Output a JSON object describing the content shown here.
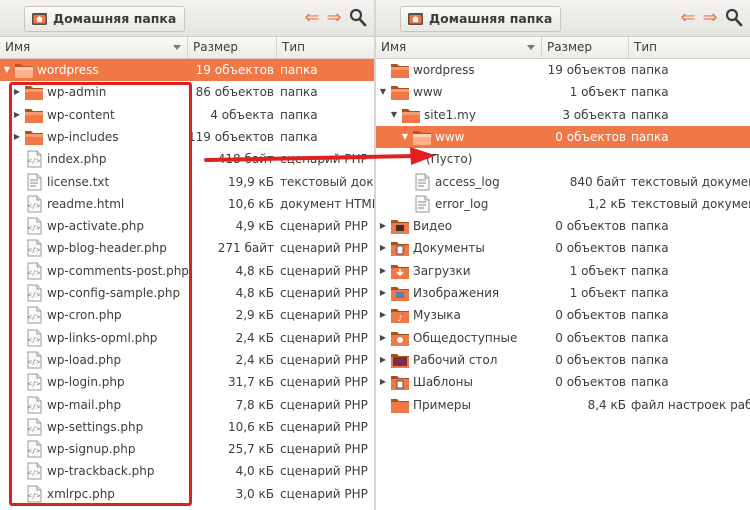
{
  "left_pane": {
    "location": "Домашняя папка",
    "columns": {
      "name": "Имя",
      "size": "Размер",
      "type": "Тип"
    },
    "rows": [
      {
        "name": "wordpress",
        "size": "19 объектов",
        "type": "папка",
        "kind": "folder",
        "expander": "open",
        "depth": 0,
        "selected": true
      },
      {
        "name": "wp-admin",
        "size": "86 объектов",
        "type": "папка",
        "kind": "folder",
        "expander": "closed",
        "depth": 1
      },
      {
        "name": "wp-content",
        "size": "4 объекта",
        "type": "папка",
        "kind": "folder",
        "expander": "closed",
        "depth": 1
      },
      {
        "name": "wp-includes",
        "size": "119 объектов",
        "type": "папка",
        "kind": "folder",
        "expander": "closed",
        "depth": 1
      },
      {
        "name": "index.php",
        "size": "418 байт",
        "type": "сценарий PHP",
        "kind": "script",
        "depth": 1
      },
      {
        "name": "license.txt",
        "size": "19,9 кБ",
        "type": "текстовый документ",
        "kind": "text",
        "depth": 1
      },
      {
        "name": "readme.html",
        "size": "10,6 кБ",
        "type": "документ HTML",
        "kind": "html",
        "depth": 1
      },
      {
        "name": "wp-activate.php",
        "size": "4,9 кБ",
        "type": "сценарий PHP",
        "kind": "script",
        "depth": 1
      },
      {
        "name": "wp-blog-header.php",
        "size": "271 байт",
        "type": "сценарий PHP",
        "kind": "script",
        "depth": 1
      },
      {
        "name": "wp-comments-post.php",
        "size": "4,8 кБ",
        "type": "сценарий PHP",
        "kind": "script",
        "depth": 1
      },
      {
        "name": "wp-config-sample.php",
        "size": "4,8 кБ",
        "type": "сценарий PHP",
        "kind": "script",
        "depth": 1
      },
      {
        "name": "wp-cron.php",
        "size": "2,9 кБ",
        "type": "сценарий PHP",
        "kind": "script",
        "depth": 1
      },
      {
        "name": "wp-links-opml.php",
        "size": "2,4 кБ",
        "type": "сценарий PHP",
        "kind": "script",
        "depth": 1
      },
      {
        "name": "wp-load.php",
        "size": "2,4 кБ",
        "type": "сценарий PHP",
        "kind": "script",
        "depth": 1
      },
      {
        "name": "wp-login.php",
        "size": "31,7 кБ",
        "type": "сценарий PHP",
        "kind": "script",
        "depth": 1
      },
      {
        "name": "wp-mail.php",
        "size": "7,8 кБ",
        "type": "сценарий PHP",
        "kind": "script",
        "depth": 1
      },
      {
        "name": "wp-settings.php",
        "size": "10,6 кБ",
        "type": "сценарий PHP",
        "kind": "script",
        "depth": 1
      },
      {
        "name": "wp-signup.php",
        "size": "25,7 кБ",
        "type": "сценарий PHP",
        "kind": "script",
        "depth": 1
      },
      {
        "name": "wp-trackback.php",
        "size": "4,0 кБ",
        "type": "сценарий PHP",
        "kind": "script",
        "depth": 1
      },
      {
        "name": "xmlrpc.php",
        "size": "3,0 кБ",
        "type": "сценарий PHP",
        "kind": "script",
        "depth": 1
      }
    ]
  },
  "right_pane": {
    "location": "Домашняя папка",
    "columns": {
      "name": "Имя",
      "size": "Размер",
      "type": "Тип"
    },
    "rows": [
      {
        "name": "wordpress",
        "size": "19 объектов",
        "type": "папка",
        "kind": "folder",
        "depth": 0
      },
      {
        "name": "www",
        "size": "1 объект",
        "type": "папка",
        "kind": "folder",
        "expander": "open",
        "depth": 0
      },
      {
        "name": "site1.my",
        "size": "3 объекта",
        "type": "папка",
        "kind": "folder",
        "expander": "open",
        "depth": 1
      },
      {
        "name": "www",
        "size": "0 объектов",
        "type": "папка",
        "kind": "folder",
        "expander": "open",
        "depth": 2,
        "selected": true
      },
      {
        "name": "(Пусто)",
        "size": "",
        "type": "",
        "kind": "none",
        "depth": 3
      },
      {
        "name": "access_log",
        "size": "840 байт",
        "type": "текстовый документ",
        "kind": "text",
        "depth": 2
      },
      {
        "name": "error_log",
        "size": "1,2 кБ",
        "type": "текстовый документ",
        "kind": "text",
        "depth": 2
      },
      {
        "name": "Видео",
        "size": "0 объектов",
        "type": "папка",
        "kind": "video",
        "expander": "closed",
        "depth": 0
      },
      {
        "name": "Документы",
        "size": "0 объектов",
        "type": "папка",
        "kind": "docs",
        "expander": "closed",
        "depth": 0
      },
      {
        "name": "Загрузки",
        "size": "1 объект",
        "type": "папка",
        "kind": "downloads",
        "expander": "closed",
        "depth": 0
      },
      {
        "name": "Изображения",
        "size": "1 объект",
        "type": "папка",
        "kind": "pictures",
        "expander": "closed",
        "depth": 0
      },
      {
        "name": "Музыка",
        "size": "0 объектов",
        "type": "папка",
        "kind": "music",
        "expander": "closed",
        "depth": 0
      },
      {
        "name": "Общедоступные",
        "size": "0 объектов",
        "type": "папка",
        "kind": "public",
        "expander": "closed",
        "depth": 0
      },
      {
        "name": "Рабочий стол",
        "size": "0 объектов",
        "type": "папка",
        "kind": "desktop",
        "expander": "closed",
        "depth": 0
      },
      {
        "name": "Шаблоны",
        "size": "0 объектов",
        "type": "папка",
        "kind": "templates",
        "expander": "closed",
        "depth": 0
      },
      {
        "name": "Примеры",
        "size": "8,4 кБ",
        "type": "файл настроек рабочего стола",
        "kind": "examples",
        "depth": 0
      }
    ]
  },
  "colors": {
    "accent": "#f07746",
    "highlight_box": "#e0201f",
    "nav_arrow": "#e2784a"
  }
}
